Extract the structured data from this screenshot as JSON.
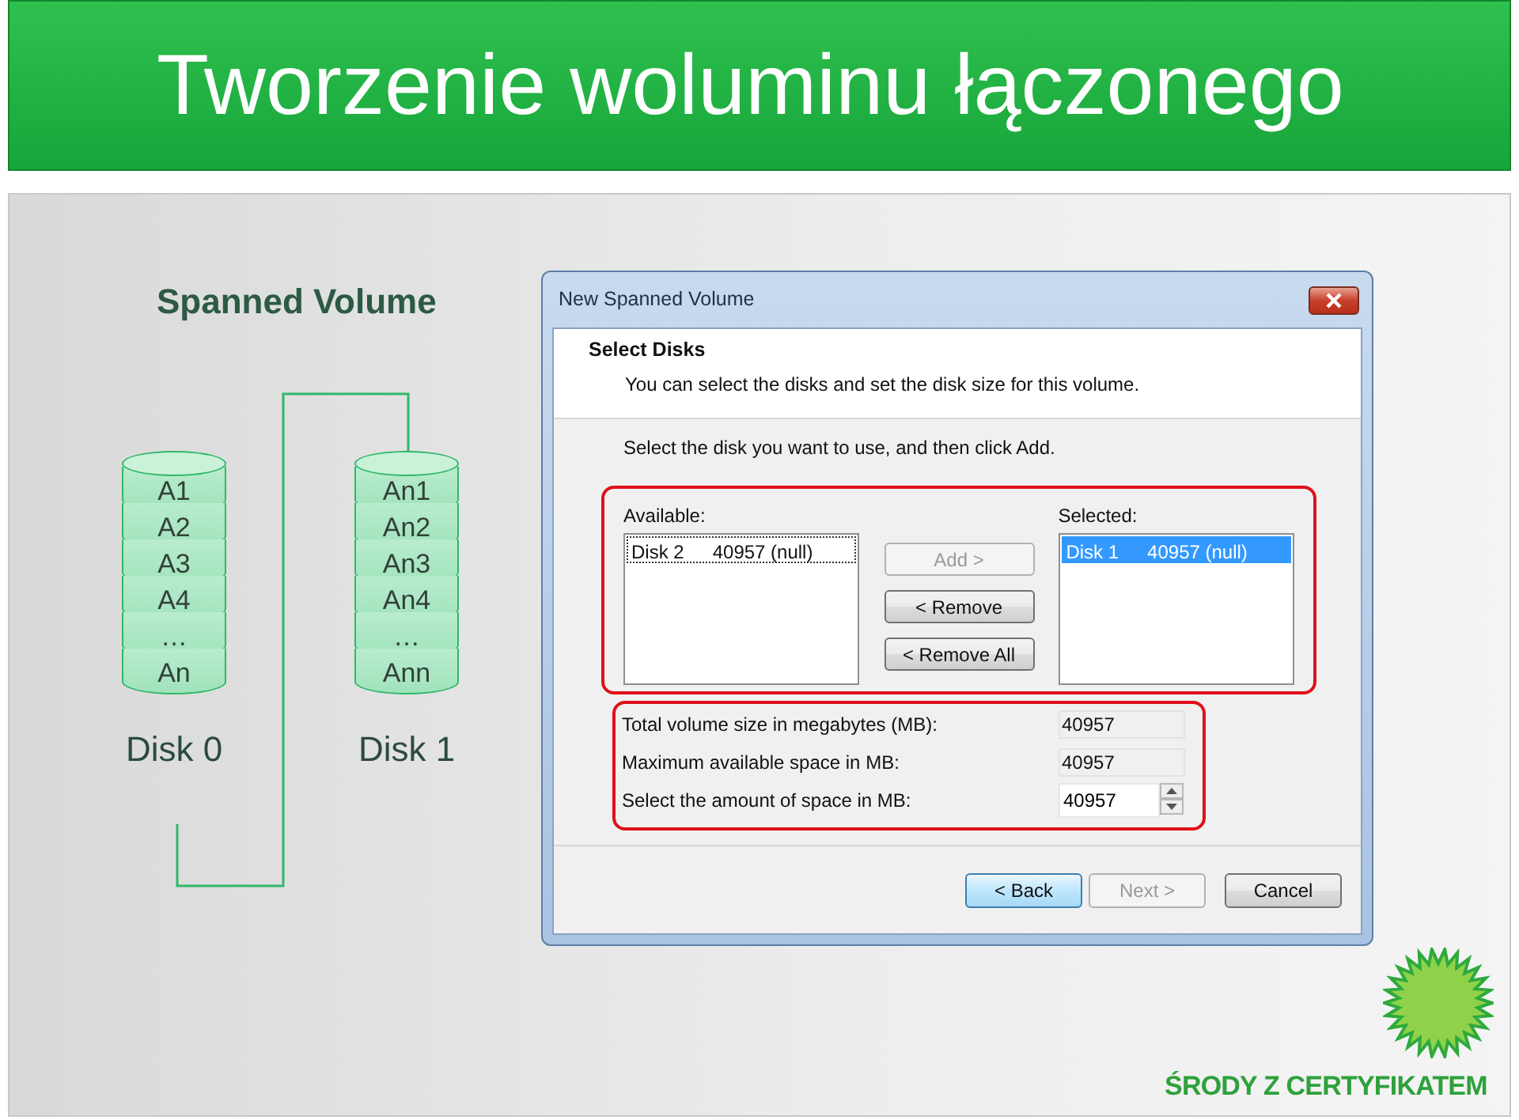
{
  "slide_title": "Tworzenie woluminu łączonego",
  "diagram": {
    "title": "Spanned Volume",
    "disks": [
      {
        "label": "Disk 0",
        "segments": [
          "A1",
          "A2",
          "A3",
          "A4",
          "…",
          "An"
        ]
      },
      {
        "label": "Disk 1",
        "segments": [
          "An1",
          "An2",
          "An3",
          "An4",
          "…",
          "Ann"
        ]
      }
    ]
  },
  "dialog": {
    "title": "New Spanned Volume",
    "header": {
      "title": "Select Disks",
      "subtitle": "You can select the disks and set the disk size for this volume."
    },
    "instruction": "Select the disk you want to use, and then click Add.",
    "available": {
      "label": "Available:",
      "items": [
        {
          "disk": "Disk 2",
          "size": "40957 (null)",
          "selected": false,
          "focused": true
        }
      ]
    },
    "selected_disks": {
      "label": "Selected:",
      "items": [
        {
          "disk": "Disk 1",
          "size": "40957 (null)",
          "selected": true,
          "focused": false
        }
      ]
    },
    "transfer_buttons": [
      {
        "label": "Add >",
        "disabled": true
      },
      {
        "label": "< Remove",
        "disabled": false
      },
      {
        "label": "< Remove All",
        "disabled": false
      }
    ],
    "fields": [
      {
        "label": "Total volume size in megabytes (MB):",
        "value": "40957",
        "kind": "readonly"
      },
      {
        "label": "Maximum available space in MB:",
        "value": "40957",
        "kind": "readonly"
      },
      {
        "label": "Select the amount of space in MB:",
        "value": "40957",
        "kind": "spinner"
      }
    ],
    "footer_buttons": [
      {
        "label": "< Back",
        "disabled": false,
        "default": true
      },
      {
        "label": "Next >",
        "disabled": true,
        "default": false
      },
      {
        "label": "Cancel",
        "disabled": false,
        "default": false
      }
    ]
  },
  "brand": {
    "text": "ŚRODY Z CERTYFIKATEM"
  }
}
